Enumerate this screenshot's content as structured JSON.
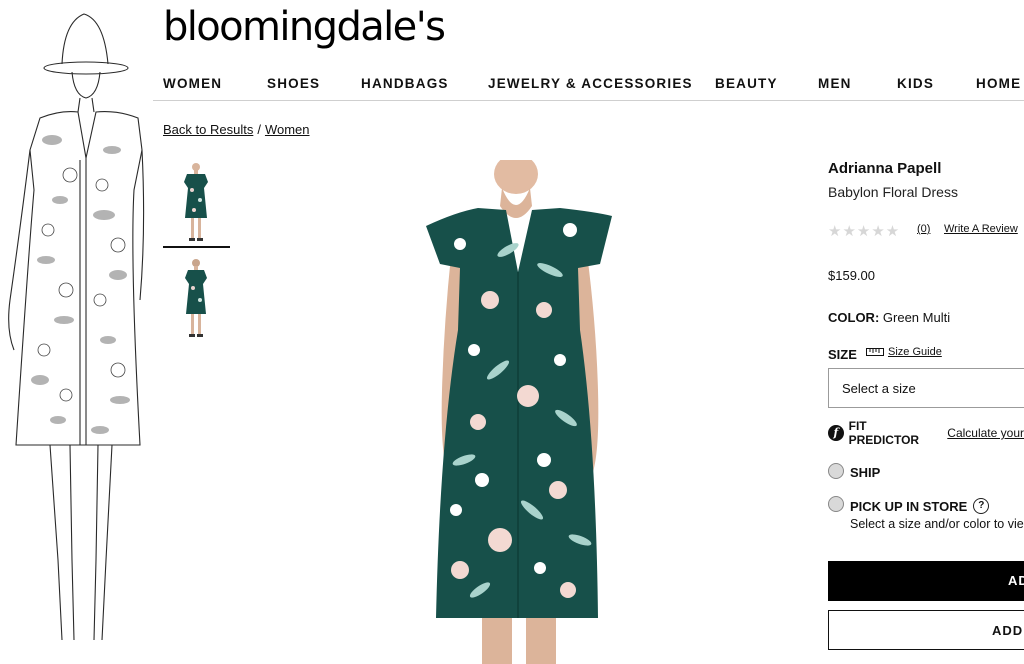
{
  "header": {
    "logo": "bloomingdale's",
    "nav": [
      "WOMEN",
      "SHOES",
      "HANDBAGS",
      "JEWELRY & ACCESSORIES",
      "BEAUTY",
      "MEN",
      "KIDS",
      "HOME"
    ]
  },
  "breadcrumb": {
    "back": "Back to Results",
    "separator": "/",
    "current": "Women"
  },
  "product": {
    "brand": "Adrianna Papell",
    "name": "Babylon Floral Dress",
    "rating_stars": 0,
    "review_count": "(0)",
    "write_review": "Write A Review",
    "price": "$159.00",
    "color_label": "COLOR:",
    "color_value": "Green Multi",
    "size_label": "SIZE",
    "size_guide": "Size Guide",
    "size_placeholder": "Select a size",
    "fit_predictor": "FIT PREDICTOR",
    "fit_calc": "Calculate your",
    "ship": "SHIP",
    "pickup": "PICK UP IN STORE",
    "pickup_help": "?",
    "pickup_note": "Select a size and/or color to vie",
    "add_bag": "AD",
    "add_list": "ADD"
  },
  "colors": {
    "dress_green": "#17504a",
    "accent": "#000000"
  }
}
